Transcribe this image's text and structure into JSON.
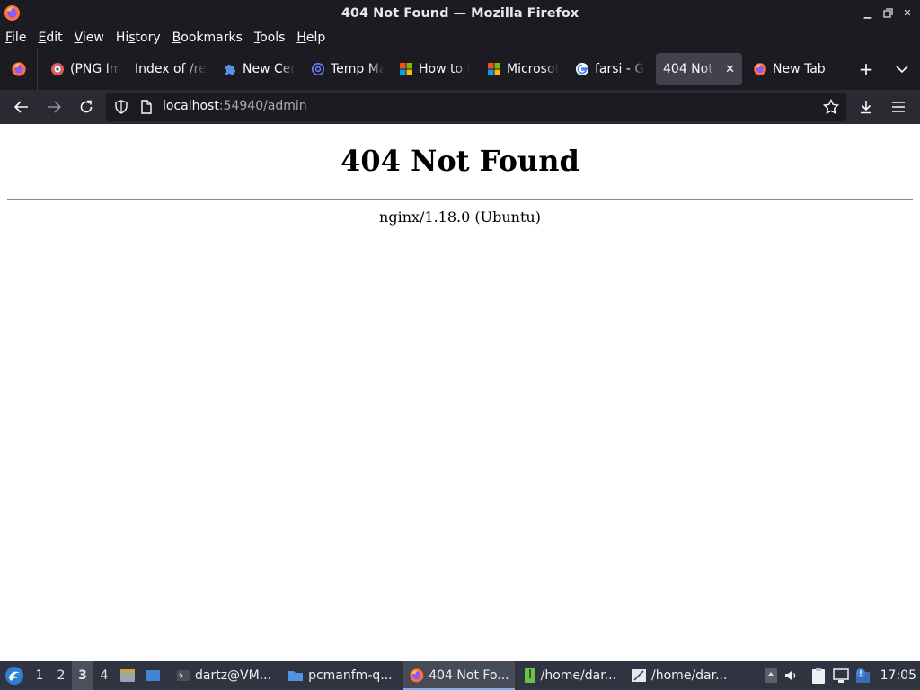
{
  "window": {
    "title": "404 Not Found — Mozilla Firefox",
    "controls": [
      "minimize",
      "restore",
      "close"
    ]
  },
  "menubar": {
    "items": [
      {
        "label": "File",
        "accel": "F"
      },
      {
        "label": "Edit",
        "accel": "E"
      },
      {
        "label": "View",
        "accel": "V"
      },
      {
        "label": "History",
        "accel": "s"
      },
      {
        "label": "Bookmarks",
        "accel": "B"
      },
      {
        "label": "Tools",
        "accel": "T"
      },
      {
        "label": "Help",
        "accel": "H"
      }
    ]
  },
  "tabs": [
    {
      "label": "(PNG Im",
      "icon": "png-image-icon"
    },
    {
      "label": "Index of /re",
      "icon": "none"
    },
    {
      "label": "New Cer",
      "icon": "puzzle-icon"
    },
    {
      "label": "Temp Ma",
      "icon": "at-sign-icon"
    },
    {
      "label": "How to i",
      "icon": "microsoft-icon"
    },
    {
      "label": "Microsof",
      "icon": "microsoft-icon"
    },
    {
      "label": "farsi - G",
      "icon": "google-icon"
    },
    {
      "label": "404 Not F",
      "icon": "none",
      "selected": true
    },
    {
      "label": "New Tab",
      "icon": "firefox-icon"
    }
  ],
  "urlbar": {
    "host": "localhost",
    "rest": ":54940/admin"
  },
  "page": {
    "heading": "404 Not Found",
    "server": "nginx/1.18.0 (Ubuntu)"
  },
  "taskbar": {
    "workspaces": [
      "1",
      "2",
      "3",
      "4"
    ],
    "active_workspace": "3",
    "tasks": [
      {
        "label": "dartz@VM...",
        "icon": "terminal-icon"
      },
      {
        "label": "pcmanfm-q...",
        "icon": "folder-icon"
      },
      {
        "label": "404 Not Fo...",
        "icon": "firefox-icon",
        "active": true
      },
      {
        "label": "/home/dar...",
        "icon": "archive-icon"
      },
      {
        "label": "/home/dar...",
        "icon": "editor-icon"
      }
    ],
    "clock": "17:05"
  },
  "colors": {
    "chrome_dark": "#1c1b22",
    "toolbar": "#2b2a33",
    "selected_tab": "#42414d",
    "taskbar": "#2f3440"
  }
}
